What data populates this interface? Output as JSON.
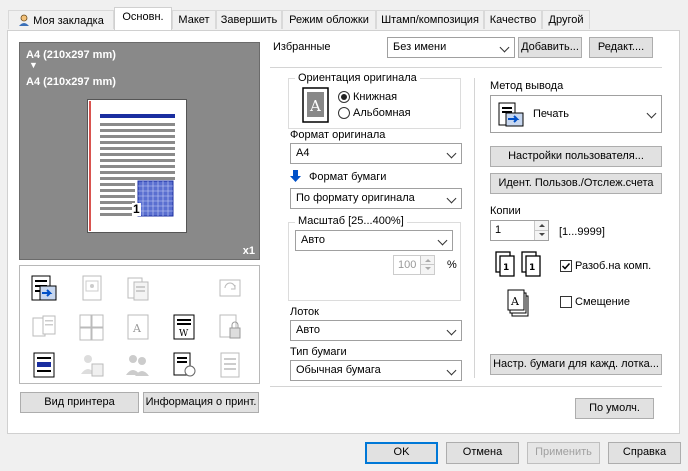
{
  "tabs": [
    {
      "label": "Моя закладка",
      "active": false
    },
    {
      "label": "Основн.",
      "active": true
    },
    {
      "label": "Макет",
      "active": false
    },
    {
      "label": "Завершить",
      "active": false
    },
    {
      "label": "Режим обложки",
      "active": false
    },
    {
      "label": "Штамп/композиция",
      "active": false
    },
    {
      "label": "Качество",
      "active": false
    },
    {
      "label": "Другой",
      "active": false
    }
  ],
  "preview": {
    "line1": "A4 (210x297 mm)",
    "arrow": "▼",
    "line2": "A4 (210x297 mm)",
    "copies_badge": "x1",
    "page_number": "1"
  },
  "printer_view_button": "Вид принтера",
  "printer_info_button": "Информация о принт.",
  "favorites": {
    "label": "Избранные",
    "value": "Без имени",
    "add_button": "Добавить...",
    "edit_button": "Редакт...."
  },
  "orientation": {
    "title": "Ориентация оригинала",
    "portrait": "Книжная",
    "landscape": "Альбомная",
    "selected": "portrait"
  },
  "original_size": {
    "label": "Формат оригинала",
    "value": "A4"
  },
  "paper_size": {
    "label": "Формат бумаги",
    "value": "По формату оригинала"
  },
  "zoom": {
    "title": "Масштаб [25...400%]",
    "value": "Авто",
    "percent": "100",
    "unit": "%"
  },
  "tray": {
    "label": "Лоток",
    "value": "Авто"
  },
  "paper_type": {
    "label": "Тип бумаги",
    "value": "Обычная бумага"
  },
  "output": {
    "label": "Метод вывода",
    "value": "Печать"
  },
  "user_settings_button": "Настройки пользователя...",
  "user_auth_button": "Идент. Пользов./Отслеж.счета",
  "copies": {
    "label": "Копии",
    "value": "1",
    "range": "[1...9999]"
  },
  "collate": {
    "label": "Разоб.на комп.",
    "checked": true
  },
  "offset": {
    "label": "Смещение",
    "checked": false
  },
  "paper_per_page_button": "Настр. бумаги для кажд. лотка...",
  "default_button": "По умолч.",
  "footer": {
    "ok": "OK",
    "cancel": "Отмена",
    "apply": "Применить",
    "help": "Справка"
  },
  "colors": {
    "accent": "#0078d7",
    "preview_bg": "#898989",
    "stripe_blue": "#1a2ea0"
  }
}
